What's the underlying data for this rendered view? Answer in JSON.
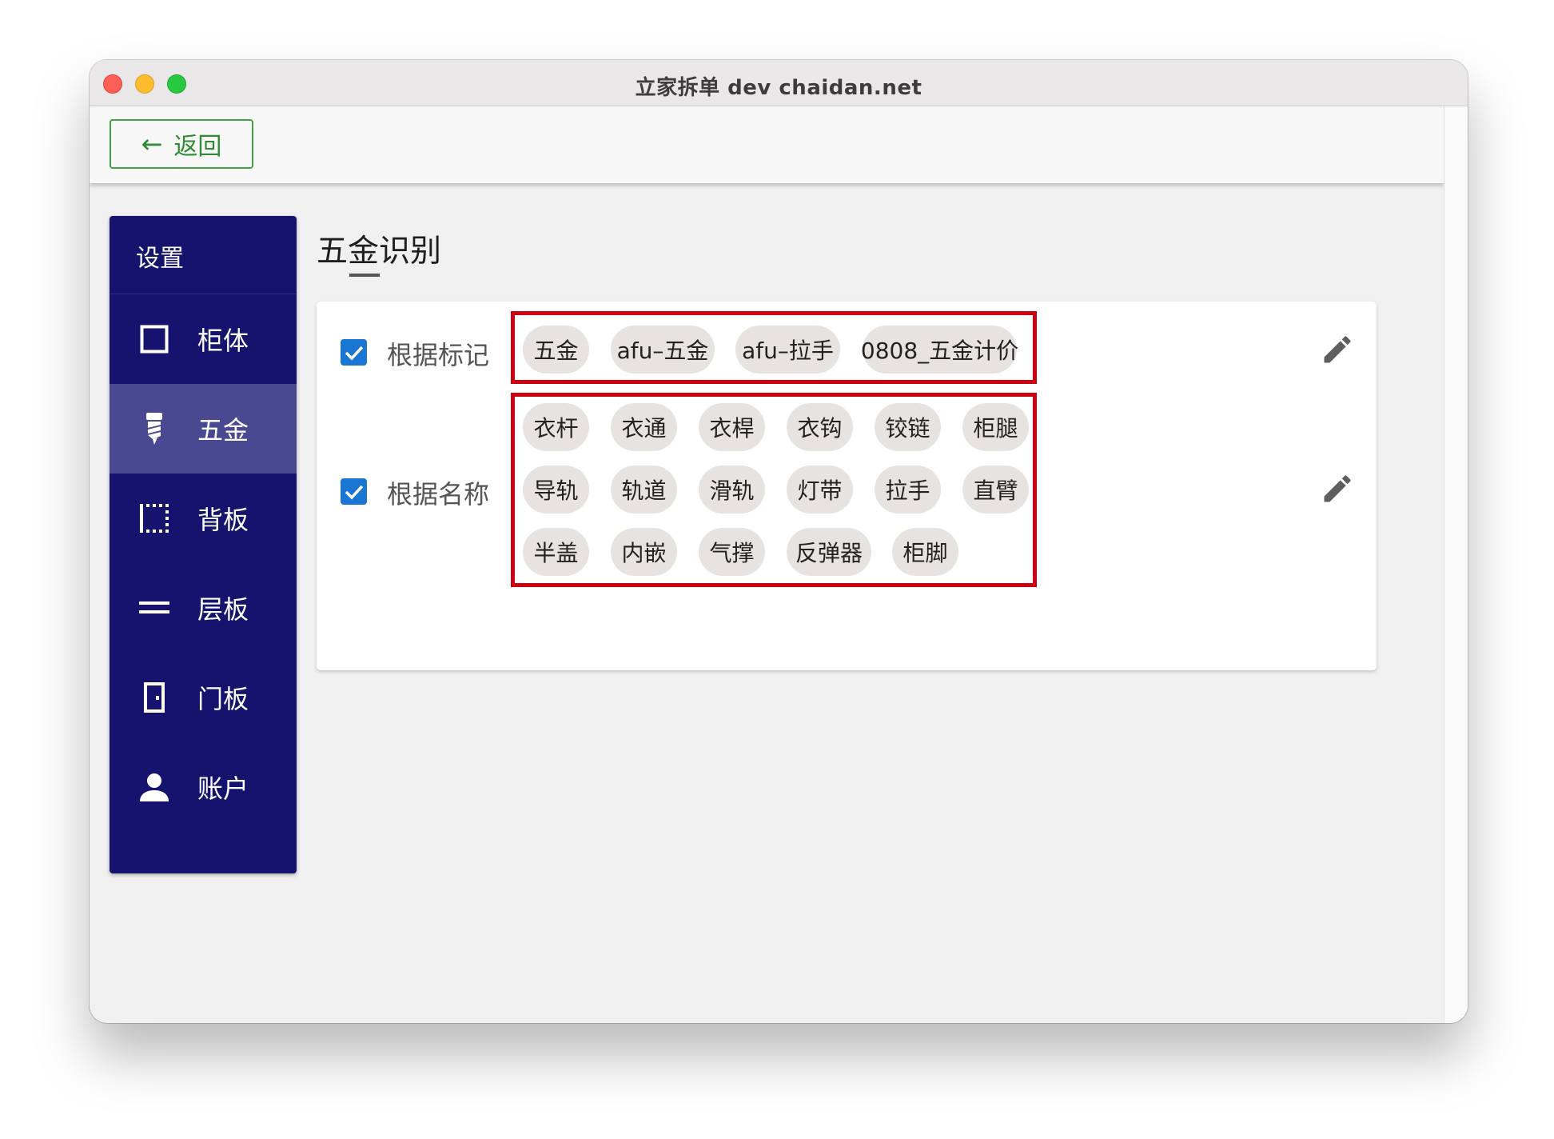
{
  "window": {
    "title": "立家拆单 dev  chaidan.net"
  },
  "appbar": {
    "back_arrow": "←",
    "back_label": "返回"
  },
  "sidebar": {
    "header": "设置",
    "items": [
      {
        "label": "柜体",
        "icon": "cabinet-square-icon",
        "active": false
      },
      {
        "label": "五金",
        "icon": "screw-icon",
        "active": true
      },
      {
        "label": "背板",
        "icon": "back-panel-dotted-icon",
        "active": false
      },
      {
        "label": "层板",
        "icon": "shelf-lines-icon",
        "active": false
      },
      {
        "label": "门板",
        "icon": "door-icon",
        "active": false
      },
      {
        "label": "账户",
        "icon": "person-icon",
        "active": false
      }
    ]
  },
  "main": {
    "title": "五金识别",
    "rules": [
      {
        "label": "根据标记",
        "checked": true,
        "chips": [
          "五金",
          "afu–五金",
          "afu–拉手",
          "0808_五金计价"
        ]
      },
      {
        "label": "根据名称",
        "checked": true,
        "chips": [
          "衣杆",
          "衣通",
          "衣桿",
          "衣钩",
          "铰链",
          "柜腿",
          "导轨",
          "轨道",
          "滑轨",
          "灯带",
          "拉手",
          "直臂",
          "半盖",
          "内嵌",
          "气撑",
          "反弹器",
          "柜脚"
        ]
      }
    ]
  },
  "colors": {
    "sidebar_bg": "#16136f",
    "sidebar_active": "#4a4890",
    "accent_green": "#43a047",
    "checkbox_blue": "#1976d2",
    "highlight_red": "#cc0011",
    "chip_bg": "#e6e3e1"
  }
}
